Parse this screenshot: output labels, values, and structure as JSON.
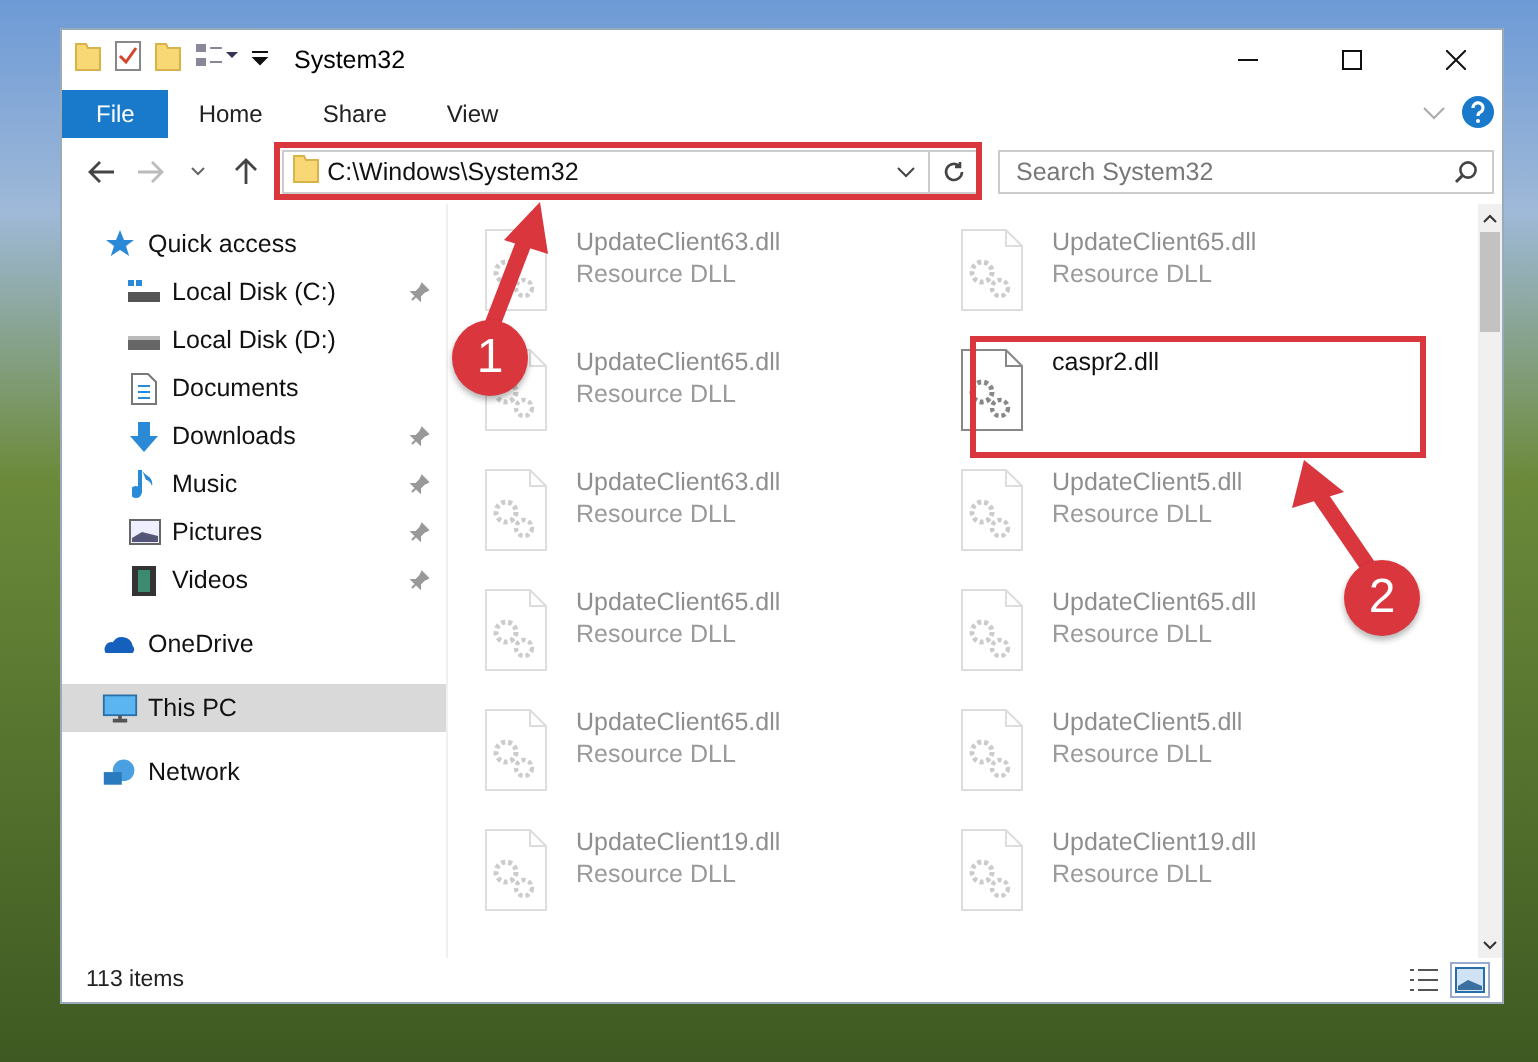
{
  "window": {
    "title": "System32"
  },
  "ribbon": {
    "tabs": [
      {
        "label": "File",
        "selected": true
      },
      {
        "label": "Home",
        "selected": false
      },
      {
        "label": "Share",
        "selected": false
      },
      {
        "label": "View",
        "selected": false
      }
    ]
  },
  "address_bar": {
    "path": "C:\\Windows\\System32"
  },
  "search": {
    "placeholder": "Search System32"
  },
  "navigation": [
    {
      "label": "Quick access",
      "kind": "favorites",
      "selected": false,
      "pinned": false,
      "children": [
        {
          "label": "Local Disk (C:)",
          "kind": "sysdrive",
          "selected": false,
          "pinned": true
        },
        {
          "label": "Local Disk (D:)",
          "kind": "drive",
          "selected": false,
          "pinned": false
        },
        {
          "label": "Documents",
          "kind": "documents",
          "selected": false,
          "pinned": false
        },
        {
          "label": "Downloads",
          "kind": "downloads",
          "selected": false,
          "pinned": true
        },
        {
          "label": "Music",
          "kind": "music",
          "selected": false,
          "pinned": true
        },
        {
          "label": "Pictures",
          "kind": "pictures",
          "selected": false,
          "pinned": true
        },
        {
          "label": "Videos",
          "kind": "videos",
          "selected": false,
          "pinned": true
        }
      ]
    },
    {
      "label": "OneDrive",
      "kind": "cloud",
      "selected": false,
      "pinned": false
    },
    {
      "label": "This PC",
      "kind": "computer",
      "selected": true,
      "pinned": false
    },
    {
      "label": "Network",
      "kind": "network",
      "selected": false,
      "pinned": false
    }
  ],
  "files": [
    {
      "name": "UpdateClient63.dll",
      "type": "Resource DLL",
      "faded": true
    },
    {
      "name": "UpdateClient65.dll",
      "type": "Resource DLL",
      "faded": true
    },
    {
      "name": "UpdateClient65.dll",
      "type": "Resource DLL",
      "faded": true
    },
    {
      "name": "caspr2.dll",
      "faded": false
    },
    {
      "name": "UpdateClient63.dll",
      "type": "Resource DLL",
      "faded": true
    },
    {
      "name": "UpdateClient5.dll",
      "type": "Resource DLL",
      "faded": true
    },
    {
      "name": "UpdateClient65.dll",
      "type": "Resource DLL",
      "faded": true
    },
    {
      "name": "UpdateClient65.dll",
      "type": "Resource DLL",
      "faded": true
    },
    {
      "name": "UpdateClient65.dll",
      "type": "Resource DLL",
      "faded": true
    },
    {
      "name": "UpdateClient5.dll",
      "type": "Resource DLL",
      "faded": true
    },
    {
      "name": "UpdateClient19.dll",
      "type": "Resource DLL",
      "faded": true
    },
    {
      "name": "UpdateClient19.dll",
      "type": "Resource DLL",
      "faded": true
    }
  ],
  "status_bar": {
    "item_count": "113 items"
  },
  "annotations": [
    {
      "number": "1"
    },
    {
      "number": "2"
    }
  ]
}
